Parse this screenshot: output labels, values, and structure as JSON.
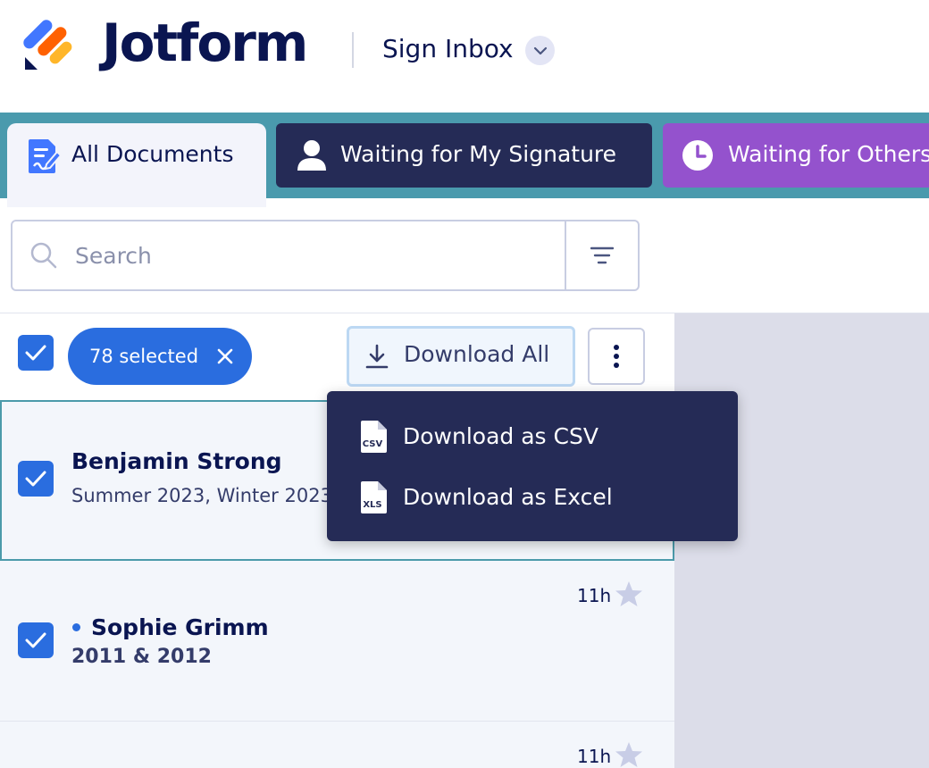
{
  "header": {
    "logo_text": "Jotform",
    "inbox_title": "Sign Inbox"
  },
  "tabs": [
    {
      "label": "All Documents",
      "icon": "document-edit-icon",
      "active": true
    },
    {
      "label": "Waiting for My Signature",
      "icon": "user-icon",
      "active": false
    },
    {
      "label": "Waiting for Others",
      "icon": "clock-icon",
      "active": false
    }
  ],
  "search": {
    "placeholder": "Search",
    "value": ""
  },
  "toolbar": {
    "selected_label": "78 selected",
    "download_all_label": "Download All"
  },
  "dropdown": {
    "items": [
      {
        "label": "Download as CSV",
        "icon_text": "CSV"
      },
      {
        "label": "Download as Excel",
        "icon_text": "XLS"
      }
    ]
  },
  "rows": [
    {
      "name": "Benjamin Strong",
      "subtitle": "Summer 2023, Winter 2023",
      "time": "",
      "unread": false,
      "checked": true
    },
    {
      "name": "Sophie Grimm",
      "subtitle": "2011 & 2012",
      "time": "11h",
      "unread": true,
      "checked": true
    },
    {
      "name": "",
      "subtitle": "",
      "time": "11h",
      "unread": false,
      "checked": false
    }
  ],
  "colors": {
    "brand_navy": "#0a1551",
    "accent_blue": "#2a6ddf",
    "tab_bar_teal": "#4a9aad",
    "tab_dark": "#252b56",
    "tab_purple": "#9452cd",
    "logo_blue": "#4277ff",
    "logo_orange": "#ff6100",
    "logo_yellow": "#ffb629"
  }
}
